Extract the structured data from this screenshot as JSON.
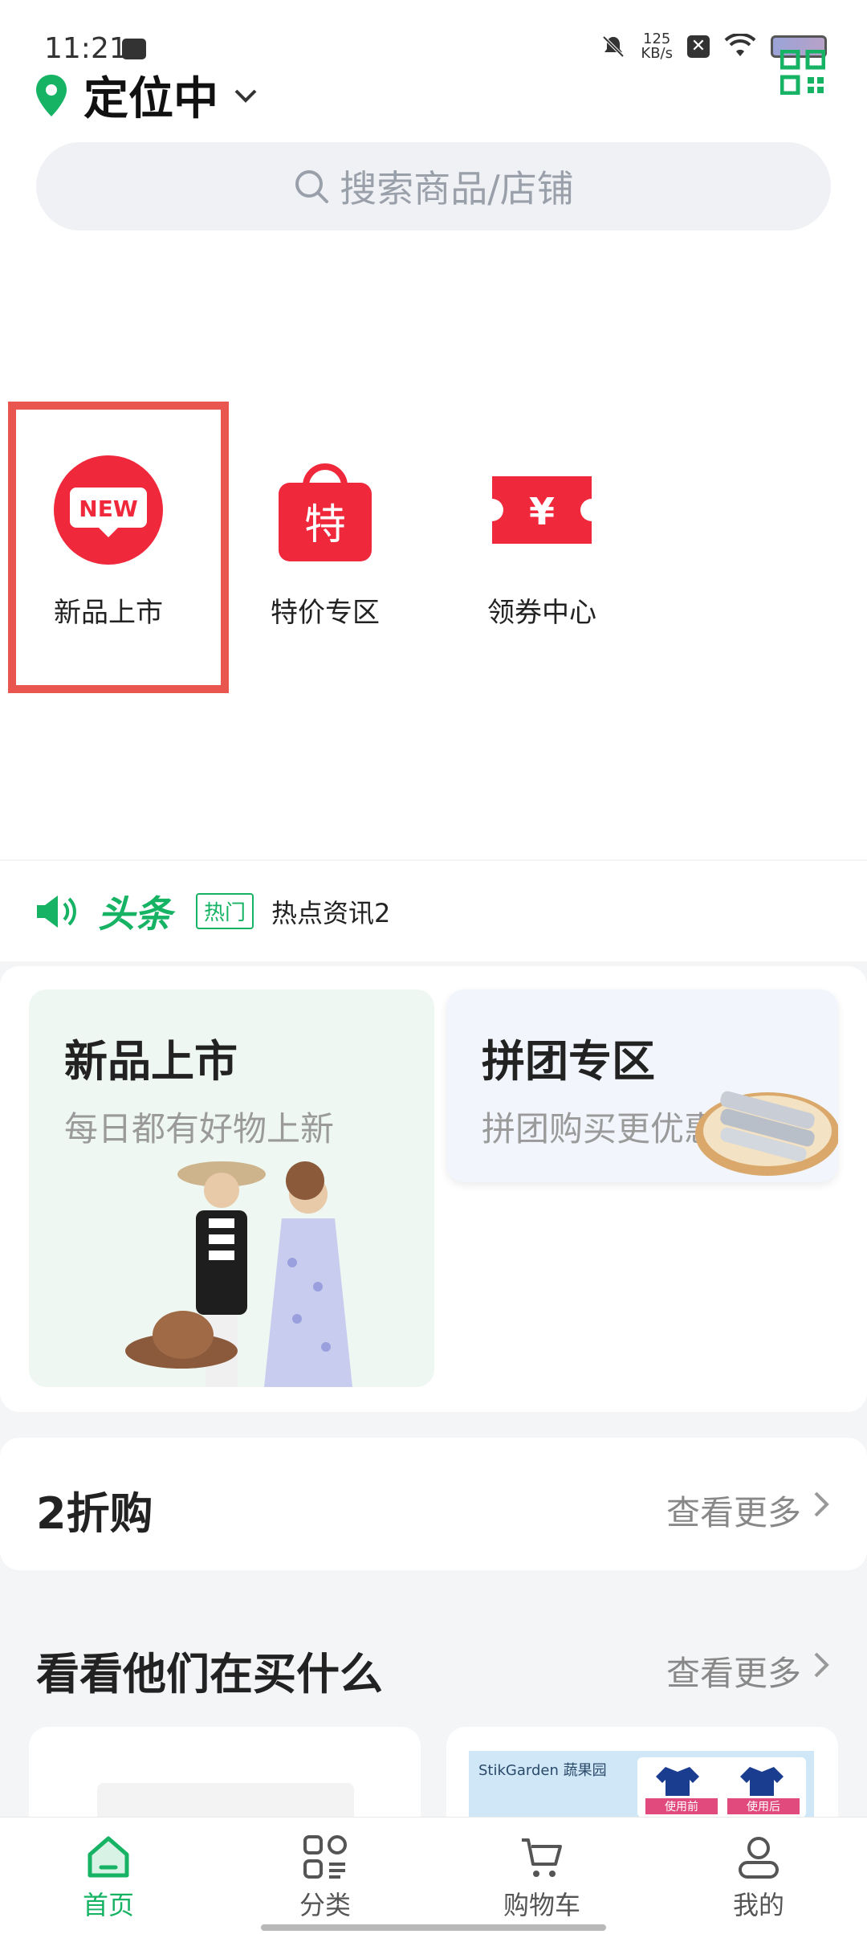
{
  "status_bar": {
    "time": "11:21",
    "net_speed_value": "125",
    "net_speed_unit": "KB/s"
  },
  "header": {
    "location": "定位中"
  },
  "search": {
    "placeholder": "搜索商品/店铺"
  },
  "shortcuts": [
    {
      "label": "新品上市",
      "icon": "new-badge-icon"
    },
    {
      "label": "特价专区",
      "icon": "shopping-bag-icon",
      "icon_text": "特"
    },
    {
      "label": "领券中心",
      "icon": "coupon-icon",
      "icon_text": "¥"
    }
  ],
  "headline": {
    "title": "头条",
    "tag": "热门",
    "news": "热点资讯2"
  },
  "promos": [
    {
      "title": "新品上市",
      "subtitle": "每日都有好物上新"
    },
    {
      "title": "拼团专区",
      "subtitle": "拼团购买更优惠"
    }
  ],
  "discount_section": {
    "title": "2折购",
    "more": "查看更多"
  },
  "buying_section": {
    "title": "看看他们在买什么",
    "more": "查看更多"
  },
  "product_brand": {
    "brand": "StikGarden 蔬果园",
    "before": "使用前",
    "after": "使用后"
  },
  "bottom_nav": [
    {
      "label": "首页",
      "icon": "home-icon",
      "active": true
    },
    {
      "label": "分类",
      "icon": "category-icon",
      "active": false
    },
    {
      "label": "购物车",
      "icon": "cart-icon",
      "active": false
    },
    {
      "label": "我的",
      "icon": "profile-icon",
      "active": false
    }
  ],
  "colors": {
    "accent": "#16b364",
    "red": "#f0283c",
    "highlight": "#e8564f"
  }
}
